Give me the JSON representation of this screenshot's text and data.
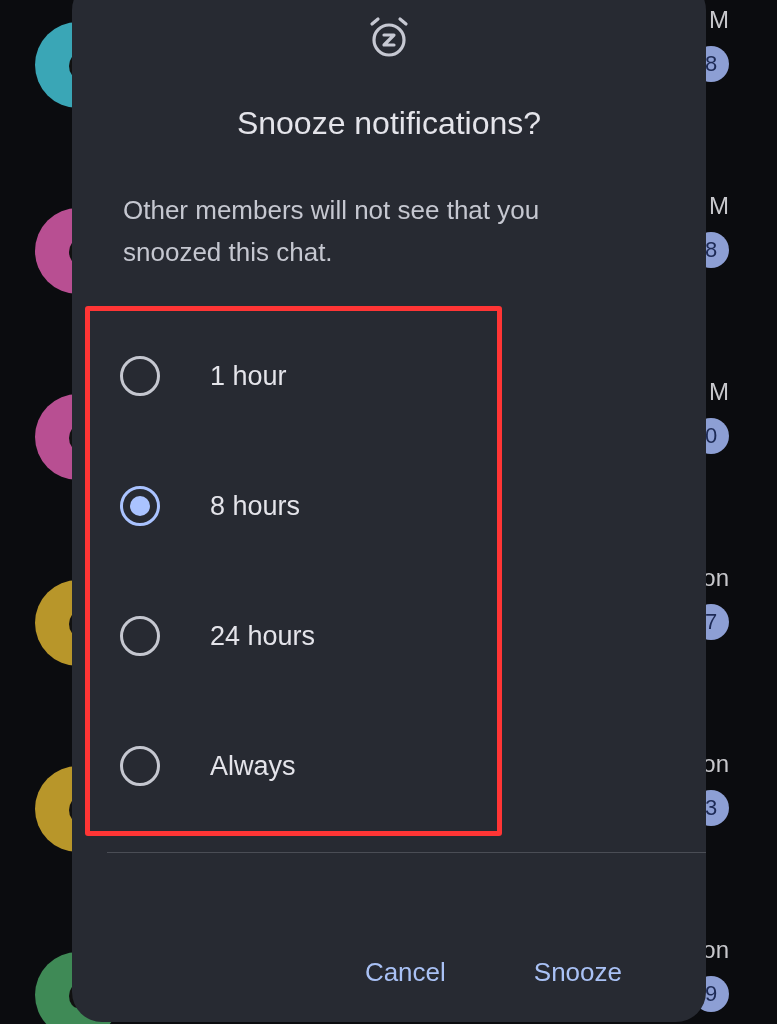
{
  "chats": [
    {
      "color": "#3aa6b6",
      "time": "M",
      "badge": "8"
    },
    {
      "color": "#b84f92",
      "time": "M",
      "badge": "8"
    },
    {
      "color": "#b84f92",
      "time": "M",
      "badge": "0"
    },
    {
      "color": "#b8962a",
      "time": "on",
      "badge": "7"
    },
    {
      "color": "#b8962a",
      "time": "on",
      "badge": "3"
    },
    {
      "color": "#3f8a56",
      "time": "on",
      "badge": "9"
    }
  ],
  "dialog": {
    "title": "Snooze notifications?",
    "message": "Other members will not see that you snoozed this chat.",
    "options_highlighted": true,
    "options": [
      {
        "label": "1 hour",
        "selected": false
      },
      {
        "label": "8 hours",
        "selected": true
      },
      {
        "label": "24 hours",
        "selected": false
      },
      {
        "label": "Always",
        "selected": false
      }
    ],
    "buttons": [
      "Cancel",
      "Snooze"
    ]
  }
}
